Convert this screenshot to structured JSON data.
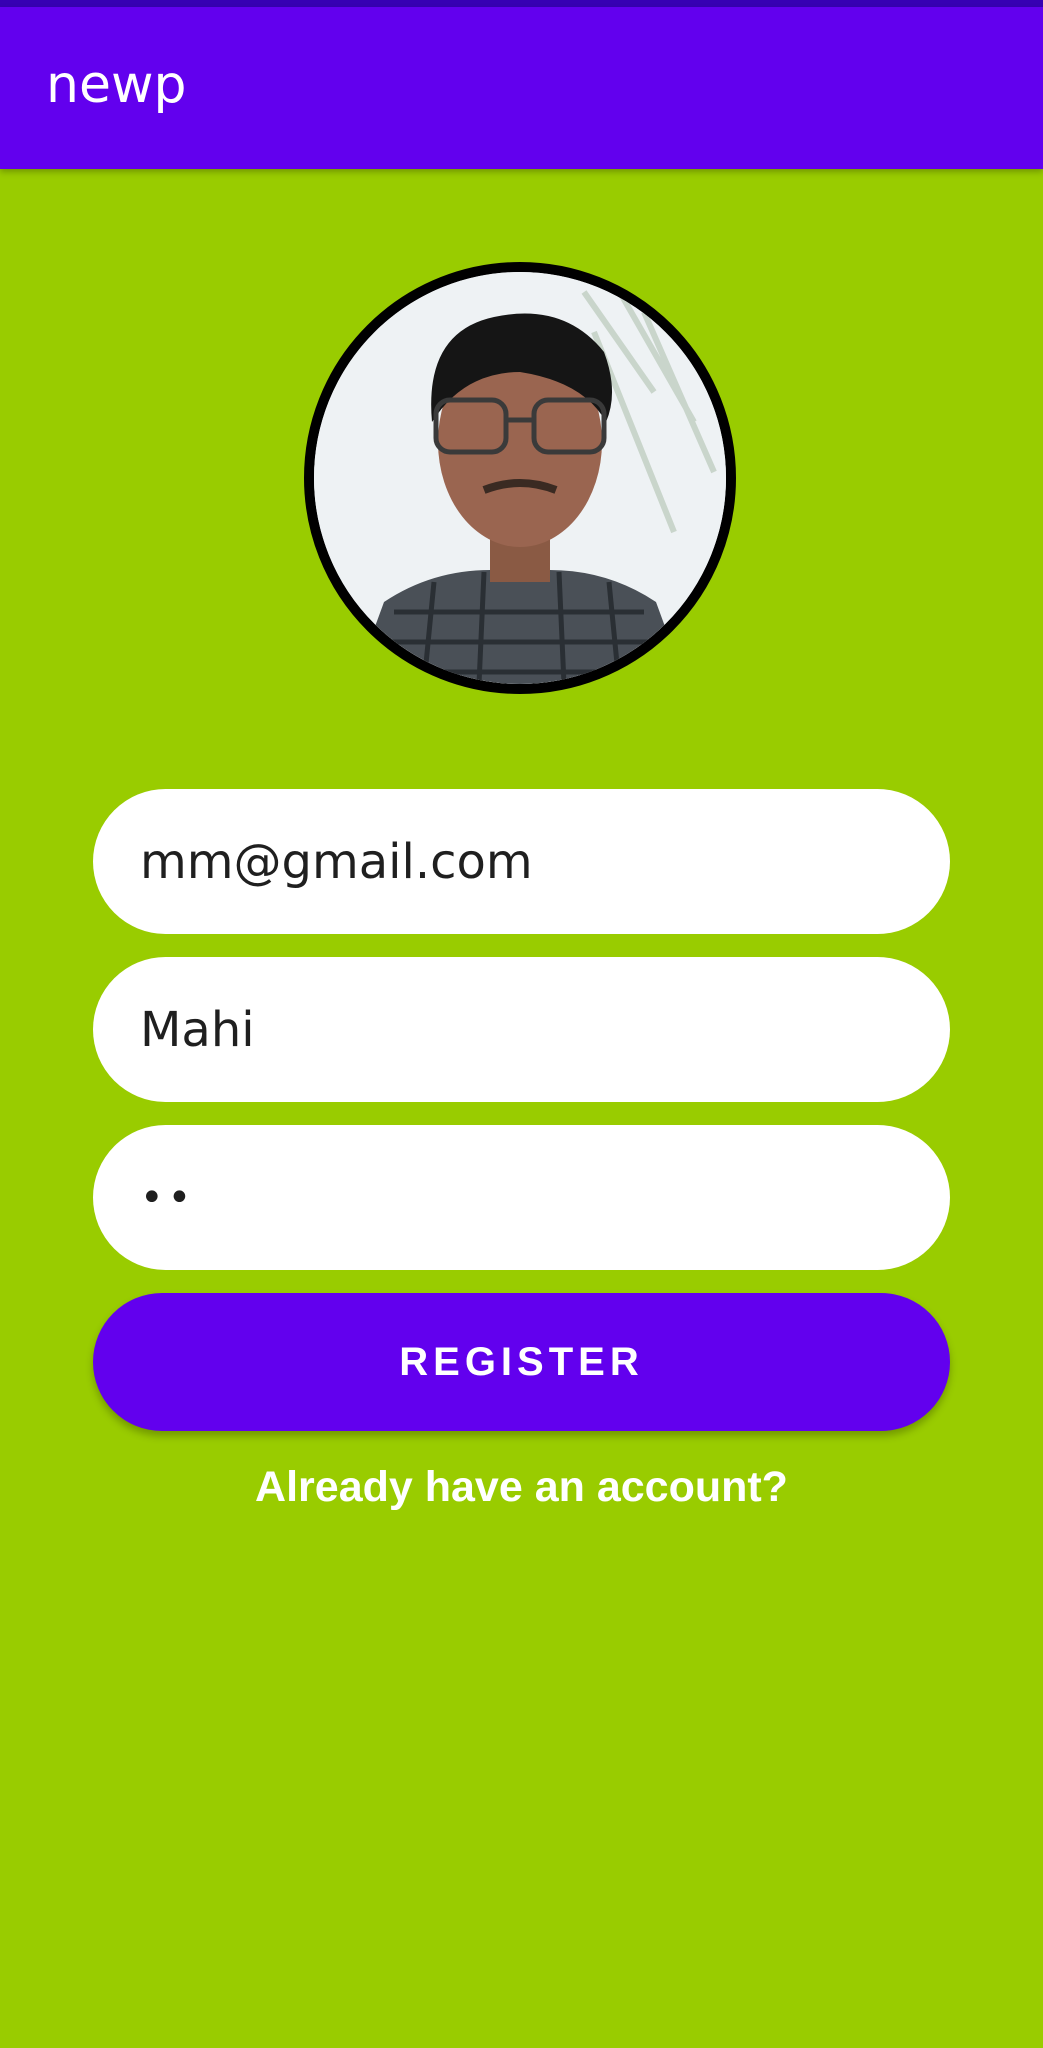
{
  "app_bar": {
    "title": "newp"
  },
  "avatar": {
    "icon": "profile-photo"
  },
  "form": {
    "email_value": "mm@gmail.com",
    "name_value": "Mahi",
    "password_value": "••",
    "register_label": "REGISTER",
    "login_link_label": "Already have an account?"
  },
  "colors": {
    "primary": "#6200ee",
    "primary_dark": "#3700b3",
    "background": "#99cc00",
    "field_bg": "#ffffff",
    "on_primary": "#ffffff"
  }
}
